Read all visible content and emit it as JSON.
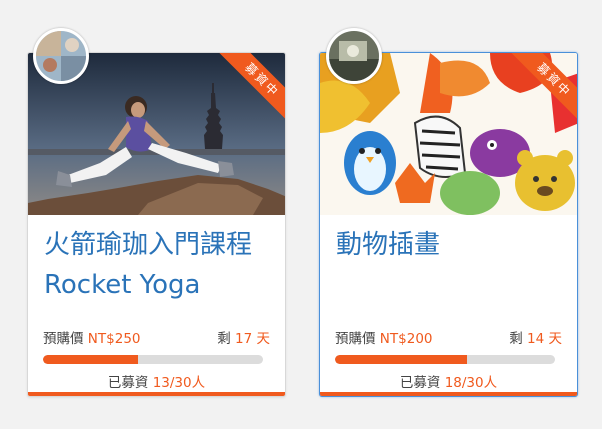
{
  "cards": [
    {
      "ribbon": "募資中",
      "title": "火箭瑜珈入門課程 Rocket Yoga",
      "price_label": "預購價",
      "price": "NT$250",
      "remain_label": "剩",
      "remain_days": "17 天",
      "raised_label": "已募資",
      "raised": "13/30人",
      "progress": 0.433
    },
    {
      "ribbon": "募資中",
      "title": "動物插畫",
      "price_label": "預購價",
      "price": "NT$200",
      "remain_label": "剩",
      "remain_days": "14 天",
      "raised_label": "已募資",
      "raised": "18/30人",
      "progress": 0.6
    }
  ],
  "colors": {
    "accent": "#f05a1e",
    "title": "#2a73b8",
    "active_border": "#4a90d9"
  }
}
